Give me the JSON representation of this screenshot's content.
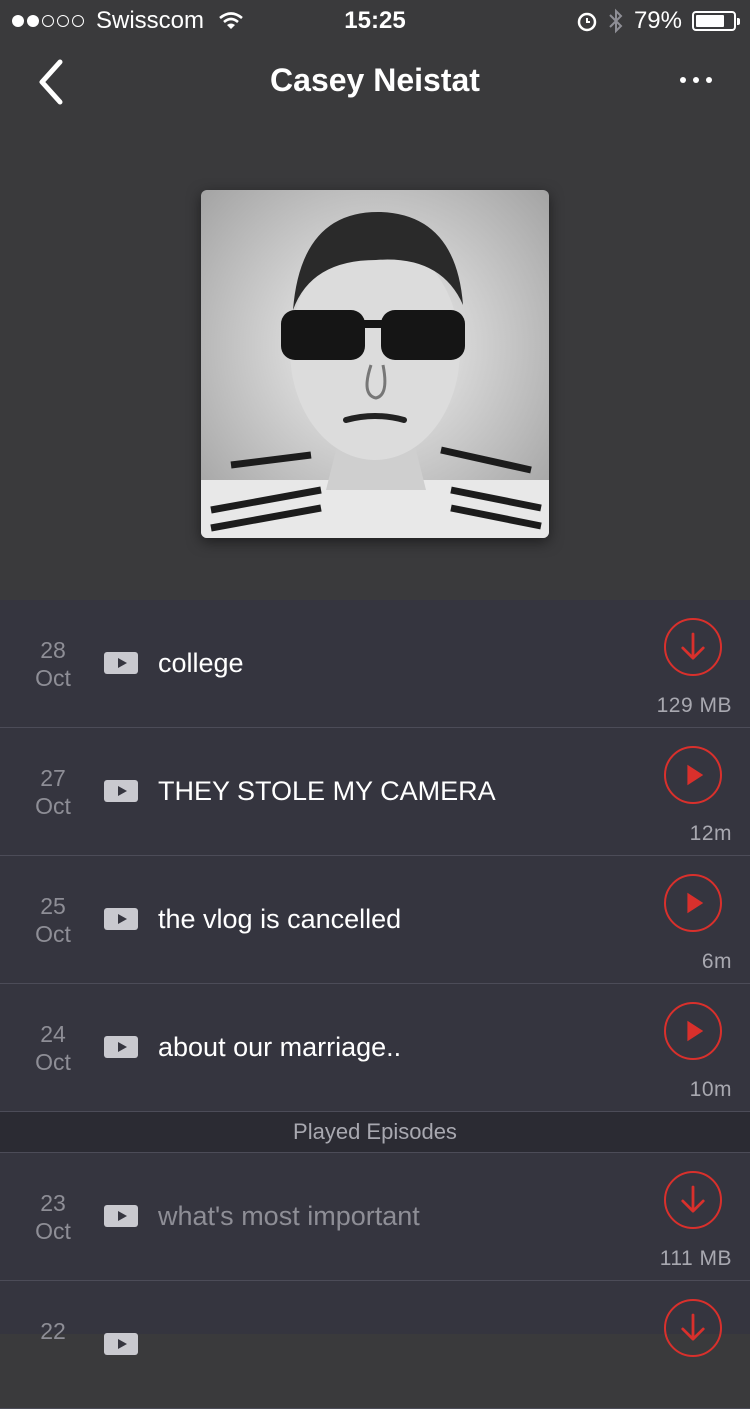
{
  "status_bar": {
    "carrier": "Swisscom",
    "signal_bars_filled": 2,
    "signal_bars_total": 5,
    "time": "15:25",
    "battery_pct_label": "79%",
    "battery_level": 0.79
  },
  "nav": {
    "title": "Casey Neistat",
    "back_icon": "chevron-left-icon",
    "more_icon": "more-dots-icon"
  },
  "colors": {
    "accent": "#d9302c",
    "list_bg": "#35353f",
    "header_bg": "#3a3a3c"
  },
  "episodes": [
    {
      "day": "28",
      "month": "Oct",
      "title": "college",
      "action": "download",
      "meta": "129 MB"
    },
    {
      "day": "27",
      "month": "Oct",
      "title": "THEY STOLE MY CAMERA",
      "action": "play",
      "meta": "12m"
    },
    {
      "day": "25",
      "month": "Oct",
      "title": "the vlog is cancelled",
      "action": "play",
      "meta": "6m"
    },
    {
      "day": "24",
      "month": "Oct",
      "title": "about our marriage..",
      "action": "play",
      "meta": "10m"
    }
  ],
  "played_section": {
    "label": "Played Episodes",
    "episodes": [
      {
        "day": "23",
        "month": "Oct",
        "title": "what's most important",
        "action": "download",
        "meta": "111 MB"
      },
      {
        "day": "22",
        "month": "",
        "title": "",
        "action": "download",
        "meta": ""
      }
    ]
  }
}
